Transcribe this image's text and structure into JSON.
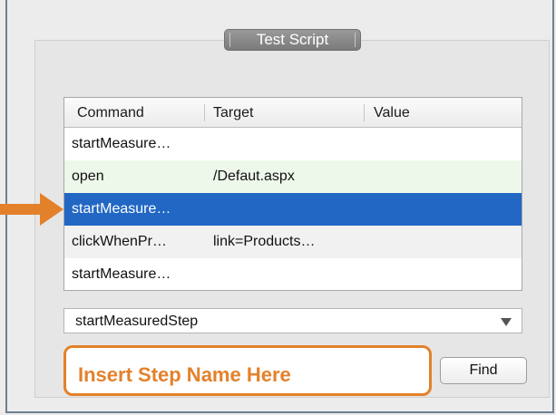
{
  "panel": {
    "title": "Test Script"
  },
  "table": {
    "headers": [
      "Command",
      "Target",
      "Value"
    ],
    "rows": [
      {
        "command": "startMeasure…",
        "target": "",
        "value": ""
      },
      {
        "command": "open",
        "target": "/Defaut.aspx",
        "value": ""
      },
      {
        "command": "startMeasure…",
        "target": "",
        "value": "",
        "selected": true
      },
      {
        "command": "clickWhenPr…",
        "target": "link=Products…",
        "value": ""
      },
      {
        "command": "startMeasure…",
        "target": "",
        "value": ""
      }
    ]
  },
  "command_select": {
    "selected": "startMeasuredStep"
  },
  "step_input": {
    "placeholder": "Insert Step Name Here"
  },
  "find_button": {
    "label": "Find"
  },
  "annotation": {
    "arrow_icon": "right-arrow-icon",
    "highlight_color": "#e3812b"
  },
  "colors": {
    "selection": "#2267c4",
    "row_green": "#edf7ea",
    "frame_border": "#6f7f92"
  }
}
